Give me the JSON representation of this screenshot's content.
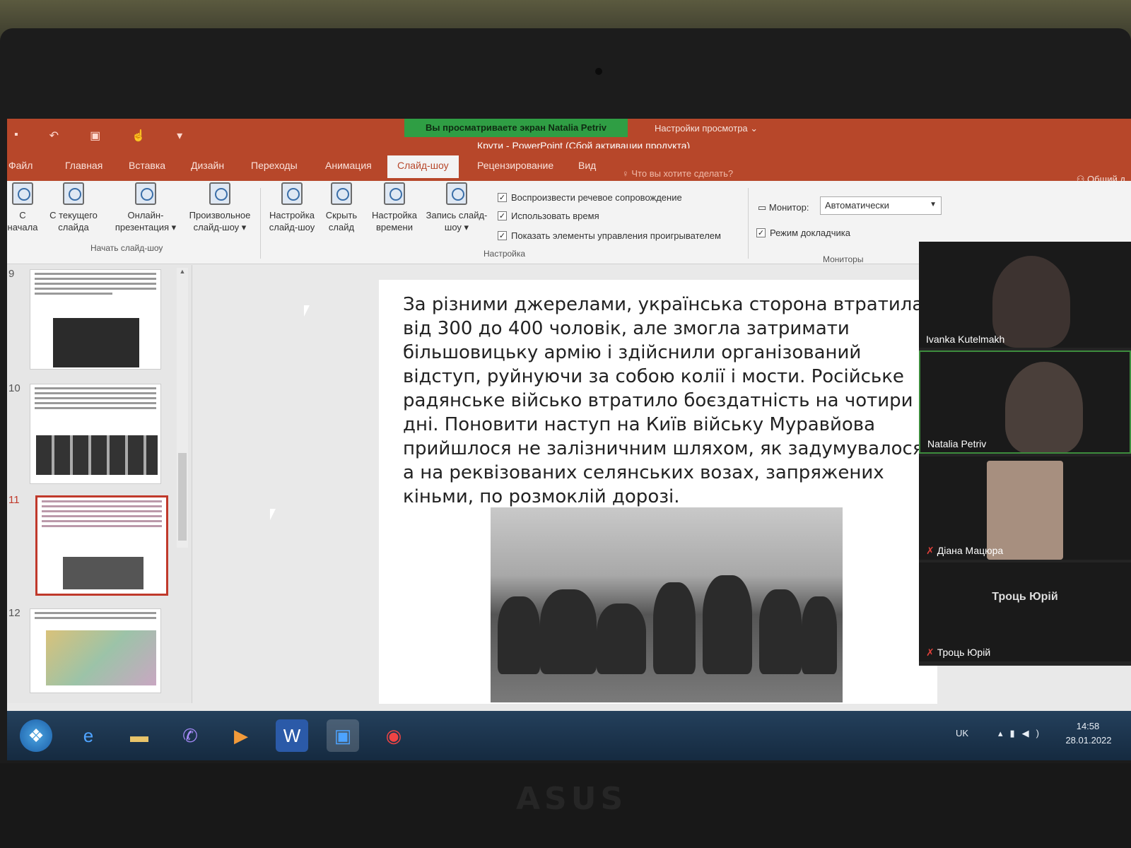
{
  "screen_share": {
    "banner": "Вы просматриваете экран Natalia Petriv",
    "view_options": "Настройки просмотра ⌄"
  },
  "window": {
    "title": "Крути - PowerPoint (Сбой активации продукта)"
  },
  "ribbon": {
    "tabs": [
      "Файл",
      "Главная",
      "Вставка",
      "Дизайн",
      "Переходы",
      "Анимация",
      "Слайд-шоу",
      "Рецензирование",
      "Вид"
    ],
    "active_tab": "Слайд-шоу",
    "tell_me": "Что вы хотите сделать?",
    "share": "Общий д",
    "start_group": {
      "label": "Начать слайд-шоу",
      "from_start": "С начала",
      "from_current": "С текущего слайда",
      "online": "Онлайн-презентация ▾",
      "custom": "Произвольное слайд-шоу ▾"
    },
    "setup_group": {
      "label": "Настройка",
      "setup": "Настройка слайд-шоу",
      "hide": "Скрыть слайд",
      "rehearse": "Настройка времени",
      "record": "Запись слайд-шоу ▾",
      "play_narrations": "Воспроизвести речевое сопровождение",
      "use_timings": "Использовать время",
      "show_media_controls": "Показать элементы управления проигрывателем"
    },
    "monitors_group": {
      "label": "Мониторы",
      "monitor_label": "Монитор:",
      "monitor_value": "Автоматически",
      "presenter_view": "Режим докладчика"
    }
  },
  "thumbnails": [
    {
      "number": "9"
    },
    {
      "number": "10"
    },
    {
      "number": "11",
      "selected": true
    },
    {
      "number": "12"
    }
  ],
  "slide": {
    "text": "За різними джерелами, українська сторона втратила від 300 до 400 чоловік, але змогла затримати більшовицьку армію і здійснили організований відступ, руйнуючи за собою колії і мости. Російське радянське військо втратило боєздатність на чотири дні. Поновити наступ на Київ війську Муравйова прийшлося не залізничним шляхом, як задумувалося, а на реквізованих селянських возах, запряжених кіньми, по розмоклій дорозі."
  },
  "participants": [
    {
      "name": "Ivanka Kutelmakh",
      "muted": false
    },
    {
      "name": "Natalia Petriv",
      "muted": false
    },
    {
      "name": "Діана Мацюра",
      "muted": true
    },
    {
      "name": "Троць Юрій",
      "muted": true,
      "display": "Троць Юрій"
    }
  ],
  "taskbar": {
    "apps": [
      "start",
      "internet-explorer",
      "file-explorer",
      "viber",
      "media-player",
      "word",
      "zoom",
      "chrome"
    ],
    "active_app": "zoom",
    "tray": {
      "language": "UK",
      "time": "14:58",
      "date": "28.01.2022"
    }
  },
  "brand": "ASUS",
  "colors": {
    "ppt_red": "#b7472a",
    "share_green": "#2f9e44",
    "selection_red": "#c0392b"
  }
}
